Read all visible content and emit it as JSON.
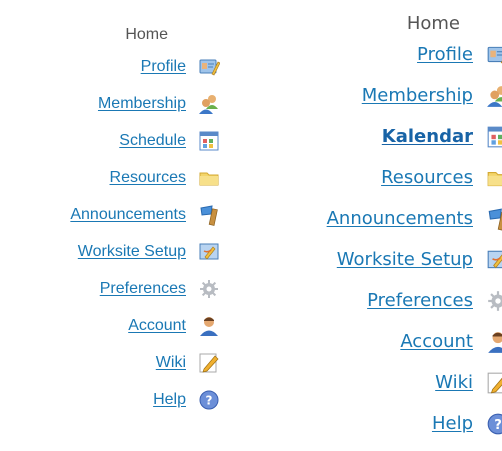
{
  "left_menu": {
    "home_label": "Home",
    "items": [
      {
        "label": "Profile",
        "icon": "profile-icon"
      },
      {
        "label": "Membership",
        "icon": "membership-icon"
      },
      {
        "label": "Schedule",
        "icon": "calendar-icon"
      },
      {
        "label": "Resources",
        "icon": "folder-icon"
      },
      {
        "label": "Announcements",
        "icon": "megaphone-icon"
      },
      {
        "label": "Worksite Setup",
        "icon": "worksite-setup-icon"
      },
      {
        "label": "Preferences",
        "icon": "gear-icon"
      },
      {
        "label": "Account",
        "icon": "account-icon"
      },
      {
        "label": "Wiki",
        "icon": "pencil-icon"
      },
      {
        "label": "Help",
        "icon": "help-icon"
      }
    ]
  },
  "right_menu": {
    "home_label": "Home",
    "items": [
      {
        "label": "Profile",
        "icon": "profile-icon"
      },
      {
        "label": "Membership",
        "icon": "membership-icon"
      },
      {
        "label": "Kalendar",
        "icon": "calendar-icon",
        "active": true
      },
      {
        "label": "Resources",
        "icon": "folder-icon"
      },
      {
        "label": "Announcements",
        "icon": "megaphone-icon"
      },
      {
        "label": "Worksite Setup",
        "icon": "worksite-setup-icon"
      },
      {
        "label": "Preferences",
        "icon": "gear-icon"
      },
      {
        "label": "Account",
        "icon": "account-icon"
      },
      {
        "label": "Wiki",
        "icon": "pencil-icon"
      },
      {
        "label": "Help",
        "icon": "help-icon"
      }
    ]
  },
  "colors": {
    "link": "#1a78b4",
    "active_link": "#1863a6",
    "home_text": "#555555"
  }
}
